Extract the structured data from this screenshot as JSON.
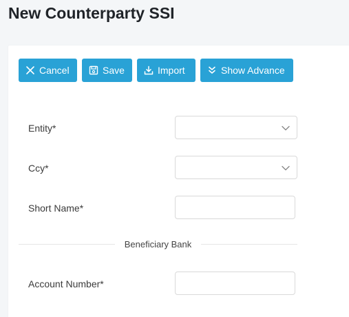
{
  "page": {
    "title": "New Counterparty SSI"
  },
  "toolbar": {
    "cancel_label": "Cancel",
    "save_label": "Save",
    "import_label": "Import",
    "show_advance_label": "Show Advance",
    "button_color": "#29a2d6"
  },
  "form": {
    "entity": {
      "label": "Entity*",
      "value": ""
    },
    "ccy": {
      "label": "Ccy*",
      "value": ""
    },
    "short_name": {
      "label": "Short Name*",
      "value": ""
    },
    "section_beneficiary": "Beneficiary Bank",
    "account_number": {
      "label": "Account Number*",
      "value": ""
    }
  },
  "icons": {
    "cancel": "close-icon",
    "save": "save-icon",
    "import": "download-icon",
    "show_advance": "double-chevron-down-icon",
    "select": "chevron-down-icon"
  }
}
